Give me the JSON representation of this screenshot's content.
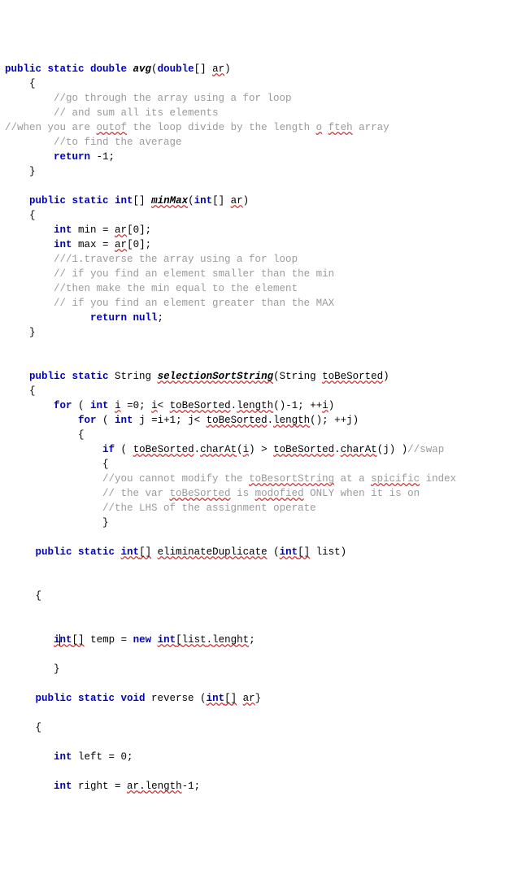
{
  "avg": {
    "sig_pre": "public static double ",
    "name": "avg",
    "params_open": "(",
    "ptype": "double",
    "brackets": "[] ",
    "pname": "ar",
    "params_close": ")",
    "lbrace": "{",
    "c1": "//go through the array using a for loop",
    "c2": "// and sum all its elements",
    "c3_pre": "//when you are ",
    "c3_err1": "outof",
    "c3_mid": " the loop divide by the length ",
    "c3_err2": "o",
    "c3_sp": " ",
    "c3_err3": "fteh",
    "c3_post": " array",
    "c4": "//to find the average",
    "ret": "return",
    "retval": " -1;",
    "rbrace": "}"
  },
  "minmax": {
    "sig_pre": "public static int",
    "brackets": "[] ",
    "name": "minMax",
    "params_open": "(",
    "ptype": "int",
    "pbrackets": "[] ",
    "pname": "ar",
    "params_close": ")",
    "lbrace": "{",
    "decl1_kw": "int",
    "decl1_rest": " min = ",
    "decl1_ar": "ar",
    "decl1_idx": "[0];",
    "decl2_kw": "int",
    "decl2_rest": " max = ",
    "decl2_ar": "ar",
    "decl2_idx": "[0];",
    "c1": "///1.traverse the array using a for loop",
    "c2": "// if you find an element smaller than the min",
    "c3": "//then make the min equal to the element",
    "c4": "// if you find an element greater than the MAX",
    "ret": "return null",
    "semi": ";",
    "rbrace": "}"
  },
  "selsort": {
    "sig_pre": "public static ",
    "rettype": "String ",
    "name": "selectionSortString",
    "params_open": "(String ",
    "pname": "toBeSorted",
    "params_close": ")",
    "lbrace": "{",
    "for1_kw": "for",
    "for1_open": " ( ",
    "for1_int": "int",
    "for1_sp": " ",
    "for1_i": "i",
    "for1_eq": " =0; ",
    "for1_i2": "i",
    "for1_lt": "< ",
    "for1_tbs": "toBeSorted",
    "for1_dot": ".",
    "for1_len": "length",
    "for1_end": "()-1; ++",
    "for1_i3": "i",
    "for1_close": ")",
    "for2_kw": "for",
    "for2_open": " ( ",
    "for2_int": "int",
    "for2_rest": " j =i+1; j< ",
    "for2_tbs": "toBeSorted",
    "for2_dot": ".",
    "for2_len": "length",
    "for2_end": "(); ++j)",
    "for2_lb": "{",
    "if_kw": "if",
    "if_open": " ( ",
    "if_tbs1": "toBeSorted",
    "if_dot1": ".",
    "if_ca1": "charAt",
    "if_i": "(",
    "if_iarg": "i",
    "if_mid": ") > ",
    "if_tbs2": "toBeSorted",
    "if_dot2": ".",
    "if_ca2": "charAt",
    "if_jend": "(j) )",
    "if_cmt": "//swap",
    "if_lb": "{",
    "c1_pre": "//you cannot modify the ",
    "c1_err1": "toBesortString",
    "c1_mid": " at a ",
    "c1_err2": "spicific",
    "c1_post": " index",
    "c2_pre": "// the var ",
    "c2_err1": "toBeSorted",
    "c2_mid": " is ",
    "c2_err2": "modofied",
    "c2_post": " ONLY when it is on",
    "c3": "//the LHS of the assignment operate",
    "if_rb": "}"
  },
  "elim": {
    "sig_pre": "public static ",
    "int": "int",
    "br1": "[]",
    "sp": " ",
    "name": "eliminateDuplicate",
    "popen": " (",
    "pint": "int",
    "pbr": "[]",
    "plist": " list)",
    "lbrace": "{",
    "tint": "i",
    "tint_caret": "nt",
    "tbr": "[]",
    "trest": " temp = ",
    "tnew": "new",
    "tsp": " ",
    "tint2": "int",
    "topen": "[",
    "tlist": "list",
    "tdot": ".",
    "tlen": "lenght",
    "tend": ";",
    "rbrace": "}"
  },
  "rev": {
    "sig_pre": "public static void",
    "name": " reverse (",
    "pint": "int",
    "pbr": "[]",
    "psp": " ",
    "par": "ar",
    "pend": "}",
    "lbrace": "{",
    "l1_kw": "int",
    "l1_rest": " left = 0;",
    "l2_kw": "int",
    "l2_rest": " right = ",
    "l2_ar": "ar",
    "l2_dot": ".",
    "l2_len": "length",
    "l2_end": "-1;"
  }
}
